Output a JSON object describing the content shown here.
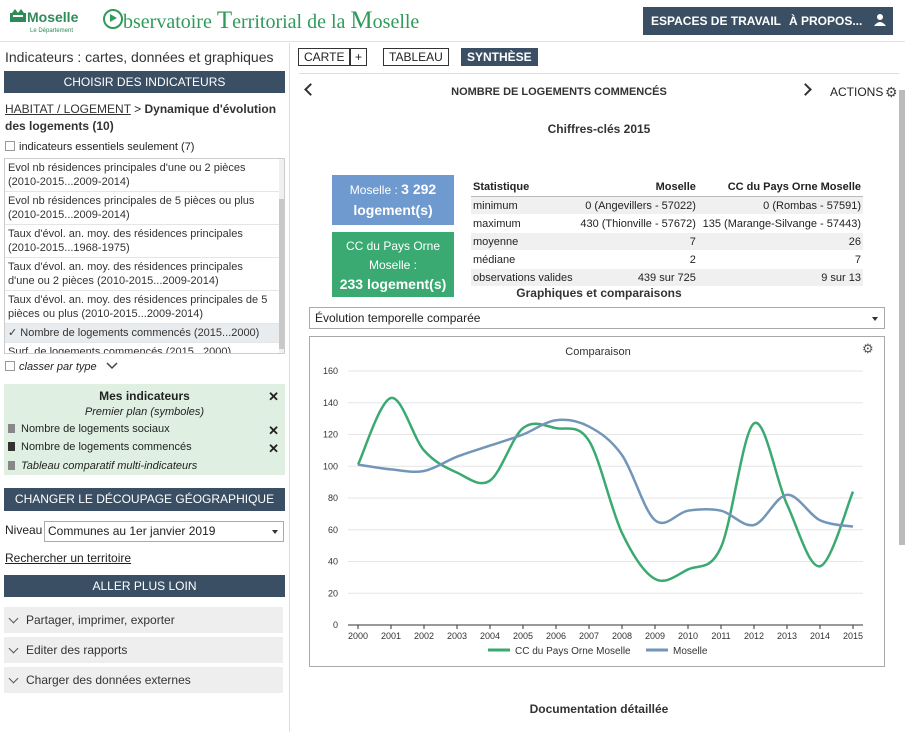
{
  "header": {
    "logo_name": "Moselle",
    "logo_sub": "Le Département",
    "title_parts": [
      "bservatoire ",
      "T",
      "erritorial de la ",
      "M",
      "oselle"
    ],
    "nav": [
      "ESPACES DE TRAVAIL",
      "À PROPOS..."
    ]
  },
  "left": {
    "title": "Indicateurs : cartes, données et graphiques",
    "choose_label": "CHOISIR DES INDICATEURS",
    "breadcrumb_link": "HABITAT / LOGEMENT",
    "breadcrumb_sep": " > ",
    "breadcrumb_current": "Dynamique d'évolution des logements (10)",
    "essentials_label": "indicateurs essentiels seulement (7)",
    "indicators": [
      "Evol nb résidences principales d'une ou 2 pièces (2010-2015...2009-2014)",
      "Evol nb résidences principales de 5 pièces ou plus (2010-2015...2009-2014)",
      "Taux d'évol. an. moy. des résidences principales (2010-2015...1968-1975)",
      "Taux d'évol. an. moy. des résidences principales d'une ou 2 pièces (2010-2015...2009-2014)",
      "Taux d'évol. an. moy. des résidences principales de 5 pièces ou plus (2010-2015...2009-2014)",
      "✓ Nombre de logements commencés (2015...2000)",
      "Surf. de logements commencés (2015...2000)"
    ],
    "classer_label": "classer par type",
    "mes_ind": {
      "title": "Mes indicateurs",
      "premier_plan": "Premier plan (symboles)",
      "items": [
        "Nombre de logements sociaux",
        "Nombre de logements commencés"
      ],
      "tableau": "Tableau comparatif multi-indicateurs",
      "close": "✕"
    },
    "decoupage_label": "CHANGER LE DÉCOUPAGE GÉOGRAPHIQUE",
    "niveau_label": "Niveau",
    "niveau_value": "Communes au 1er janvier 2019",
    "recherche_label": "Rechercher un territoire",
    "aller_label": "ALLER PLUS LOIN",
    "accordions": [
      "Partager, imprimer, exporter",
      "Editer des rapports",
      "Charger des données externes"
    ]
  },
  "main": {
    "tabs": [
      "CARTE",
      "+",
      "TABLEAU",
      "SYNTHÈSE"
    ],
    "indicator_title": "NOMBRE DE LOGEMENTS COMMENCÉS",
    "actions_label": "ACTIONS",
    "chiffres_title": "Chiffres-clés 2015",
    "card1_a": "Moselle : ",
    "card1_b": "3 292",
    "card1_c": "logement(s)",
    "card2_a": "CC du Pays Orne",
    "card2_b": "Moselle :",
    "card2_c": "233 logement(s)",
    "stats_headers": [
      "Statistique",
      "Moselle",
      "CC du Pays Orne Moselle"
    ],
    "stats_rows": [
      [
        "minimum",
        "0 (Angevillers - 57022)",
        "0 (Rombas - 57591)"
      ],
      [
        "maximum",
        "430 (Thionville - 57672)",
        "135 (Marange-Silvange - 57443)"
      ],
      [
        "moyenne",
        "7",
        "26"
      ],
      [
        "médiane",
        "2",
        "7"
      ],
      [
        "observations valides",
        "439 sur 725",
        "9 sur 13"
      ]
    ],
    "graph_title": "Graphiques et comparaisons",
    "evo_select": "Évolution temporelle comparée",
    "doc_title": "Documentation détaillée"
  },
  "colors": {
    "dark": "#3b4f64",
    "green_series": "#3aaa72",
    "blue_series": "#7396b8",
    "card_blue": "#6e9ad0",
    "card_green": "#3aaa72",
    "mes_bg": "#dff0e2"
  },
  "chart_data": {
    "type": "line",
    "title": "Comparaison",
    "categories": [
      "2000",
      "2001",
      "2002",
      "2003",
      "2004",
      "2005",
      "2006",
      "2007",
      "2008",
      "2009",
      "2010",
      "2011",
      "2012",
      "2013",
      "2014",
      "2015"
    ],
    "series": [
      {
        "name": "CC du Pays Orne Moselle",
        "values": [
          101,
          143,
          110,
          96,
          91,
          124,
          124,
          116,
          58,
          29,
          35,
          49,
          127,
          76,
          37,
          84
        ]
      },
      {
        "name": "Moselle",
        "values": [
          101,
          98,
          97,
          106,
          113,
          120,
          129,
          125,
          107,
          66,
          72,
          72,
          63,
          82,
          66,
          62
        ]
      }
    ],
    "yticks": [
      0,
      20,
      40,
      60,
      80,
      100,
      120,
      140,
      160
    ],
    "ylim": [
      0,
      160
    ],
    "grid": true,
    "legend": "bottom"
  }
}
